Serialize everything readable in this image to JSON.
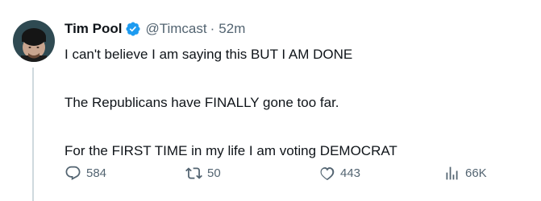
{
  "tweet": {
    "display_name": "Tim Pool",
    "handle": "@Timcast",
    "separator": "·",
    "time": "52m",
    "lines": [
      "I can't believe I am saying this BUT I AM DONE",
      "The Republicans have FINALLY gone too far.",
      "For the FIRST TIME in my life I am voting DEMOCRAT"
    ]
  },
  "actions": {
    "replies": "584",
    "retweets": "50",
    "likes": "443",
    "views": "66K"
  },
  "icons": {
    "verified": "verified-badge-icon",
    "reply": "reply-bubble-icon",
    "retweet": "retweet-arrows-icon",
    "like": "heart-icon",
    "views": "bar-chart-icon"
  },
  "colors": {
    "verified": "#1d9bf0",
    "text": "#0f1419",
    "muted": "#536471",
    "thread_line": "#cfd9de"
  }
}
